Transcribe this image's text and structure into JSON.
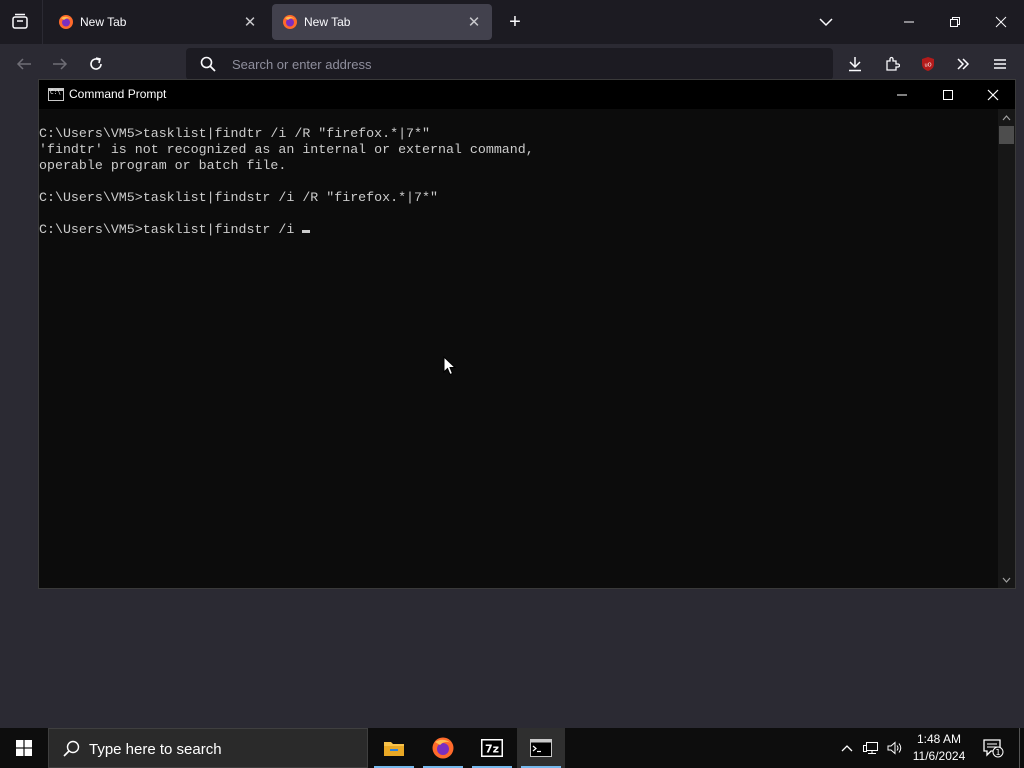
{
  "browser": {
    "tabs": [
      {
        "title": "New Tab",
        "active": false
      },
      {
        "title": "New Tab",
        "active": true
      }
    ],
    "address_placeholder": "Search or enter address",
    "accent": "#42414d"
  },
  "cmd": {
    "title": "Command Prompt",
    "icon_text": "C:\\",
    "lines": [
      "C:\\Users\\VM5>tasklist|findtr /i /R \"firefox.*|7*\"",
      "'findtr' is not recognized as an internal or external command,",
      "operable program or batch file.",
      "",
      "C:\\Users\\VM5>tasklist|findstr /i /R \"firefox.*|7*\"",
      "",
      "C:\\Users\\VM5>tasklist|findstr /i "
    ]
  },
  "taskbar": {
    "search_placeholder": "Type here to search",
    "apps": [
      "file-explorer",
      "firefox",
      "7-zip",
      "command-prompt"
    ],
    "time": "1:48 AM",
    "date": "11/6/2024",
    "notification_count": "1"
  }
}
